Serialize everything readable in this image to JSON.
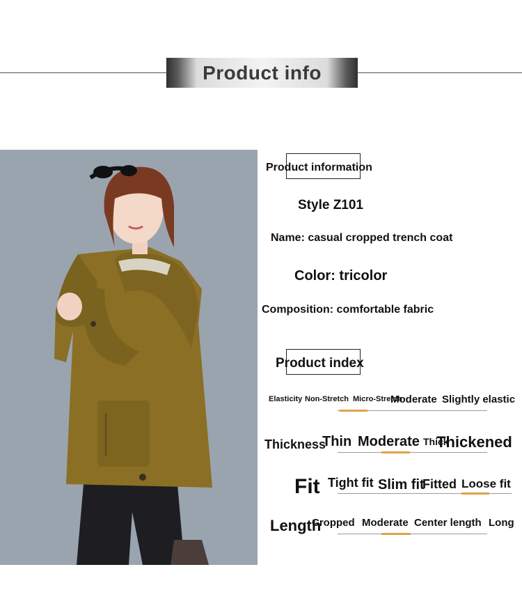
{
  "header": {
    "title": "Product info"
  },
  "details": {
    "section_title": "Product information",
    "style": "Style Z101",
    "name": "Name: casual cropped trench coat",
    "color": "Color: tricolor",
    "composition": "Composition: comfortable fabric"
  },
  "index": {
    "section_title": "Product index",
    "elasticity": {
      "label": "Elasticity",
      "options": [
        "Non-Stretch",
        "Micro-Stretch",
        "Moderate",
        "Slightly elastic"
      ],
      "selected": "Micro-Stretch"
    },
    "thickness": {
      "label": "Thickness",
      "options": [
        "Thin",
        "Moderate",
        "Thick",
        "Thickened"
      ],
      "selected": "Moderate"
    },
    "fit": {
      "label": "Fit",
      "options": [
        "Tight fit",
        "Slim fit",
        "Fitted",
        "Loose fit"
      ],
      "selected": "Loose fit"
    },
    "length": {
      "label": "Length",
      "options": [
        "Cropped",
        "Moderate",
        "Center length",
        "Long"
      ],
      "selected": "Moderate"
    }
  },
  "colors": {
    "accent": "#e0a24a",
    "coat": "#8a6f24",
    "background": "#ffffff"
  }
}
